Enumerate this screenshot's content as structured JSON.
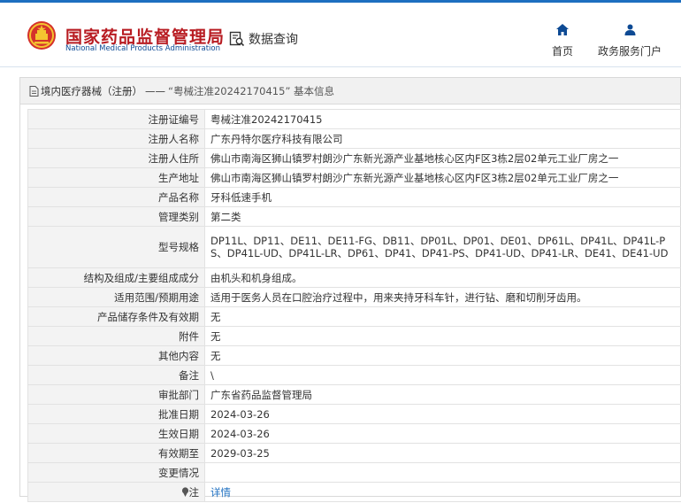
{
  "header": {
    "brand_cn": "国家药品监督管理局",
    "brand_en": "National Medical Products Administration",
    "query_label": "数据查询",
    "nav": [
      {
        "label": "首页",
        "icon": "home-icon"
      },
      {
        "label": "政务服务门户",
        "icon": "user-icon"
      }
    ]
  },
  "panel": {
    "breadcrumb": "境内医疗器械（注册）",
    "separator": "——",
    "title": "“粤械注准20242170415” 基本信息"
  },
  "fields": [
    {
      "key": "注册证编号",
      "value": "粤械注准20242170415"
    },
    {
      "key": "注册人名称",
      "value": "广东丹特尔医疗科技有限公司"
    },
    {
      "key": "注册人住所",
      "value": "佛山市南海区狮山镇罗村朗沙广东新光源产业基地核心区内F区3栋2层02单元工业厂房之一"
    },
    {
      "key": "生产地址",
      "value": "佛山市南海区狮山镇罗村朗沙广东新光源产业基地核心区内F区3栋2层02单元工业厂房之一"
    },
    {
      "key": "产品名称",
      "value": "牙科低速手机"
    },
    {
      "key": "管理类别",
      "value": "第二类"
    },
    {
      "key": "型号规格",
      "value": "DP11L、DP11、DE11、DE11-FG、DB11、DP01L、DP01、DE01、DP61L、DP41L、DP41L-PS、DP41L-UD、DP41L-LR、DP61、DP41、DP41-PS、DP41-UD、DP41-LR、DE41、DE41-UD"
    },
    {
      "key": "结构及组成/主要组成成分",
      "value": "由机头和机身组成。"
    },
    {
      "key": "适用范围/预期用途",
      "value": "适用于医务人员在口腔治疗过程中，用来夹持牙科车针，进行钻、磨和切削牙齿用。"
    },
    {
      "key": "产品储存条件及有效期",
      "value": "无"
    },
    {
      "key": "附件",
      "value": "无"
    },
    {
      "key": "其他内容",
      "value": "无"
    },
    {
      "key": "备注",
      "value": "\\"
    },
    {
      "key": "审批部门",
      "value": "广东省药品监督管理局"
    },
    {
      "key": "批准日期",
      "value": "2024-03-26"
    },
    {
      "key": "生效日期",
      "value": "2024-03-26"
    },
    {
      "key": "有效期至",
      "value": "2029-03-25"
    },
    {
      "key": "变更情况",
      "value": ""
    }
  ],
  "note": {
    "key": "注",
    "link": "详情",
    "icon": "pin-icon"
  },
  "colors": {
    "brand_red": "#b81c22",
    "brand_blue": "#0d4a94",
    "link_blue": "#1e6fc0"
  }
}
